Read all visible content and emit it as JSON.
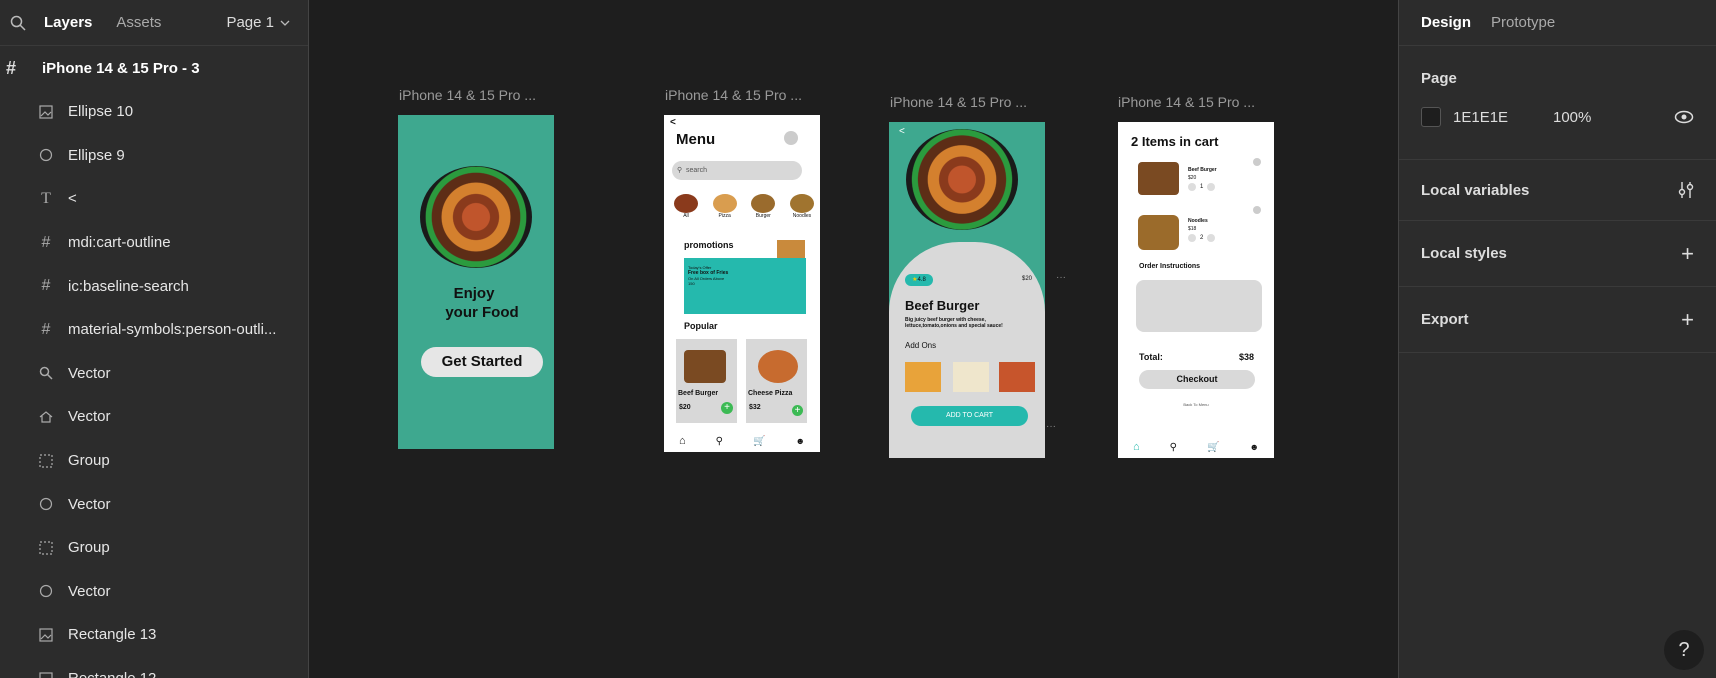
{
  "left_panel": {
    "tabs": [
      "Layers",
      "Assets"
    ],
    "page": "Page 1",
    "root_layer": "iPhone 14 & 15 Pro - 3",
    "layers": [
      {
        "name": "Ellipse 10",
        "icon": "image-icon"
      },
      {
        "name": "Ellipse 9",
        "icon": "ellipse-icon"
      },
      {
        "name": "<",
        "icon": "text-icon"
      },
      {
        "name": "mdi:cart-outline",
        "icon": "frame-icon"
      },
      {
        "name": "ic:baseline-search",
        "icon": "frame-icon"
      },
      {
        "name": "material-symbols:person-outli...",
        "icon": "frame-icon"
      },
      {
        "name": "Vector",
        "icon": "search-icon"
      },
      {
        "name": "Vector",
        "icon": "home-icon"
      },
      {
        "name": "Group",
        "icon": "group-icon"
      },
      {
        "name": "Vector",
        "icon": "ellipse-icon"
      },
      {
        "name": "Group",
        "icon": "group-icon"
      },
      {
        "name": "Vector",
        "icon": "ellipse-icon"
      },
      {
        "name": "Rectangle 13",
        "icon": "image-icon"
      },
      {
        "name": "Rectangle 12",
        "icon": "image-icon"
      }
    ]
  },
  "canvas": {
    "frame_labels": [
      "iPhone 14 & 15 Pro ...",
      "iPhone 14 & 15 Pro ...",
      "iPhone 14 & 15 Pro ...",
      "iPhone 14 & 15 Pro ..."
    ],
    "frame1": {
      "title_line1": "Enjoy",
      "title_line2": "your Food",
      "button": "Get Started"
    },
    "frame2": {
      "back": "<",
      "title": "Menu",
      "search_placeholder": "search",
      "categories": [
        "All",
        "Pizza",
        "Burger",
        "Noodles"
      ],
      "promotions": "promotions",
      "promo_line1": "Today's Offer",
      "promo_line2": "Free box of Fries",
      "promo_line3": "On All Orders Above",
      "promo_line4": "150",
      "popular": "Popular",
      "item1_name": "Beef Burger",
      "item1_price": "$20",
      "item2_name": "Cheese Pizza",
      "item2_price": "$32"
    },
    "frame3": {
      "back": "<",
      "rating": "4.8",
      "price": "$20",
      "title": "Beef Burger",
      "desc": "Big juicy beef burger with cheese, lettuce,tomato,onions and special sauce!",
      "addons": "Add Ons",
      "cta": "ADD TO CART"
    },
    "frame4": {
      "title": "2 Items in cart",
      "item1_name": "Beef Burger",
      "item1_price": "$20",
      "item1_qty": "1",
      "item2_name": "Noodles",
      "item2_price": "$18",
      "item2_qty": "2",
      "instructions": "Order Instructions",
      "total_label": "Total:",
      "total_value": "$38",
      "checkout": "Checkout",
      "back_to_menu": "Back To Menu"
    },
    "colors": {
      "teal": "#3ea88f",
      "teal_bright": "#25b9ad",
      "green": "#3cba54"
    }
  },
  "right_panel": {
    "tabs": [
      "Design",
      "Prototype"
    ],
    "page_label": "Page",
    "page_color": "1E1E1E",
    "page_opacity": "100%",
    "sections": [
      "Local variables",
      "Local styles",
      "Export"
    ],
    "help": "?"
  }
}
